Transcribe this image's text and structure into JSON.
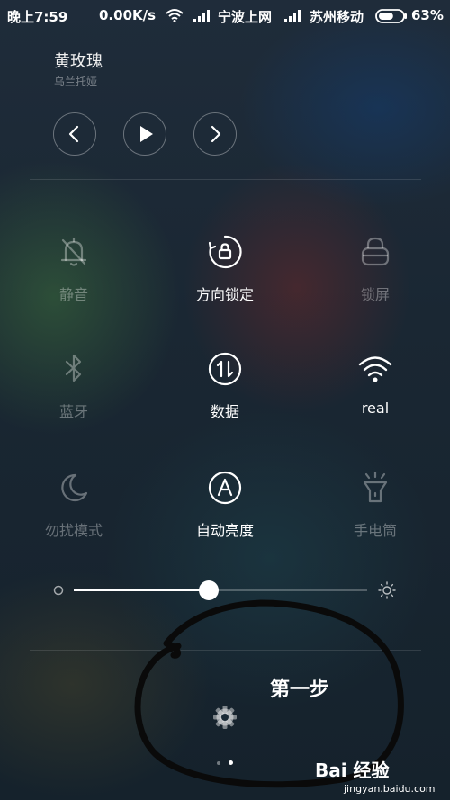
{
  "status_bar": {
    "time": "晚上7:59",
    "speed": "0.00K/s",
    "carrier1": "宁波上网",
    "carrier2": "苏州移动",
    "battery": "63%",
    "battery_level": 0.63
  },
  "media": {
    "title": "黄玫瑰",
    "artist": "乌兰托娅",
    "prev_icon": "chevron-left-icon",
    "play_icon": "play-icon",
    "next_icon": "chevron-right-icon"
  },
  "toggles": [
    {
      "label": "静音",
      "icon": "bell-mute-icon",
      "active": false
    },
    {
      "label": "方向锁定",
      "icon": "rotation-lock-icon",
      "active": true
    },
    {
      "label": "锁屏",
      "icon": "lock-icon",
      "active": false
    },
    {
      "label": "蓝牙",
      "icon": "bluetooth-icon",
      "active": false
    },
    {
      "label": "数据",
      "icon": "data-icon",
      "active": true
    },
    {
      "label": "real",
      "icon": "wifi-icon",
      "active": true
    },
    {
      "label": "勿扰模式",
      "icon": "moon-icon",
      "active": false
    },
    {
      "label": "自动亮度",
      "icon": "auto-brightness-icon",
      "active": true
    },
    {
      "label": "手电筒",
      "icon": "flashlight-icon",
      "active": false
    }
  ],
  "brightness": {
    "level": 0.46
  },
  "settings": {
    "icon": "gear-icon"
  },
  "pager": {
    "count": 2,
    "active": 1
  },
  "annotation": {
    "text": "第一步"
  },
  "watermark": {
    "logo": "Bai 经验",
    "url": "jingyan.baidu.com"
  }
}
